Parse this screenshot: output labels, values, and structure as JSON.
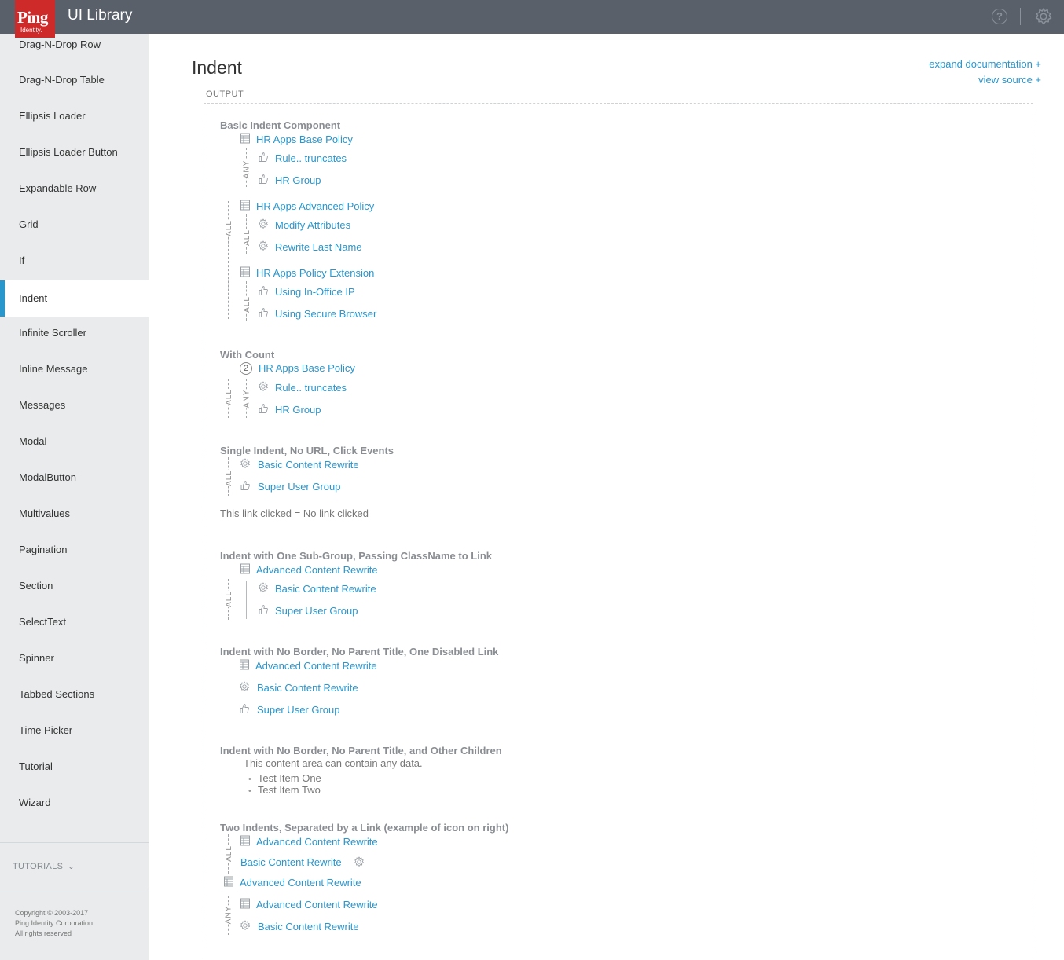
{
  "header": {
    "logo_main": "Ping",
    "logo_sub": "Identity.",
    "title": "UI Library",
    "help_glyph": "?"
  },
  "sidebar": {
    "items": [
      {
        "label": "Drag-N-Drop Row"
      },
      {
        "label": "Drag-N-Drop Table"
      },
      {
        "label": "Ellipsis Loader"
      },
      {
        "label": "Ellipsis Loader Button"
      },
      {
        "label": "Expandable Row"
      },
      {
        "label": "Grid"
      },
      {
        "label": "If"
      },
      {
        "label": "Indent"
      },
      {
        "label": "Infinite Scroller"
      },
      {
        "label": "Inline Message"
      },
      {
        "label": "Messages"
      },
      {
        "label": "Modal"
      },
      {
        "label": "ModalButton"
      },
      {
        "label": "Multivalues"
      },
      {
        "label": "Pagination"
      },
      {
        "label": "Section"
      },
      {
        "label": "SelectText"
      },
      {
        "label": "Spinner"
      },
      {
        "label": "Tabbed Sections"
      },
      {
        "label": "Time Picker"
      },
      {
        "label": "Tutorial"
      },
      {
        "label": "Wizard"
      }
    ],
    "active": "Indent",
    "tutorials_label": "TUTORIALS",
    "copyright": [
      "Copyright © 2003-2017",
      "Ping Identity Corporation",
      "All rights reserved"
    ]
  },
  "main": {
    "title": "Indent",
    "expand_doc": "expand documentation +",
    "view_source": "view source +",
    "output_label": "OUTPUT"
  },
  "demo": {
    "basic": {
      "title": "Basic Indent Component",
      "g1": "HR Apps Base Policy",
      "g1_rule": "Rule.. truncates",
      "g1_group": "HR Group",
      "g2": "HR Apps Advanced Policy",
      "g2_a": "Modify Attributes",
      "g2_b": "Rewrite Last Name",
      "g3": "HR Apps Policy Extension",
      "g3_a": "Using In-Office IP",
      "g3_b": "Using Secure Browser"
    },
    "count": {
      "title": "With Count",
      "count_value": "2",
      "parent": "HR Apps Base Policy",
      "a": "Rule.. truncates",
      "b": "HR Group"
    },
    "single": {
      "title": "Single Indent, No URL, Click Events",
      "a": "Basic Content Rewrite",
      "b": "Super User Group",
      "status": "This link clicked = No link clicked"
    },
    "subgroup": {
      "title": "Indent with One Sub-Group, Passing ClassName to Link",
      "parent": "Advanced Content Rewrite",
      "a": "Basic Content Rewrite",
      "b": "Super User Group"
    },
    "noborder": {
      "title": "Indent with No Border, No Parent Title, One Disabled Link",
      "a": "Advanced Content Rewrite",
      "b": "Basic Content Rewrite",
      "c": "Super User Group"
    },
    "children": {
      "title": "Indent with No Border, No Parent Title, and Other Children",
      "text": "This content area can contain any data.",
      "items": [
        "Test Item One",
        "Test Item Two"
      ]
    },
    "two": {
      "title": "Two Indents, Separated by a Link (example of icon on right)",
      "a": "Advanced Content Rewrite",
      "b": "Basic Content Rewrite",
      "sep": "Advanced Content Rewrite",
      "c": "Advanced Content Rewrite",
      "d": "Basic Content Rewrite"
    }
  },
  "labels": {
    "any": "ANY",
    "all": "ALL"
  },
  "icons": [
    "policy-icon",
    "thumb-icon",
    "gear-icon",
    "question-icon",
    "chevron-down-icon"
  ],
  "colors": {
    "header": "#59606a",
    "brand": "#cf2a2a",
    "accent": "#2996cc",
    "sidebar": "#e9ebec"
  }
}
